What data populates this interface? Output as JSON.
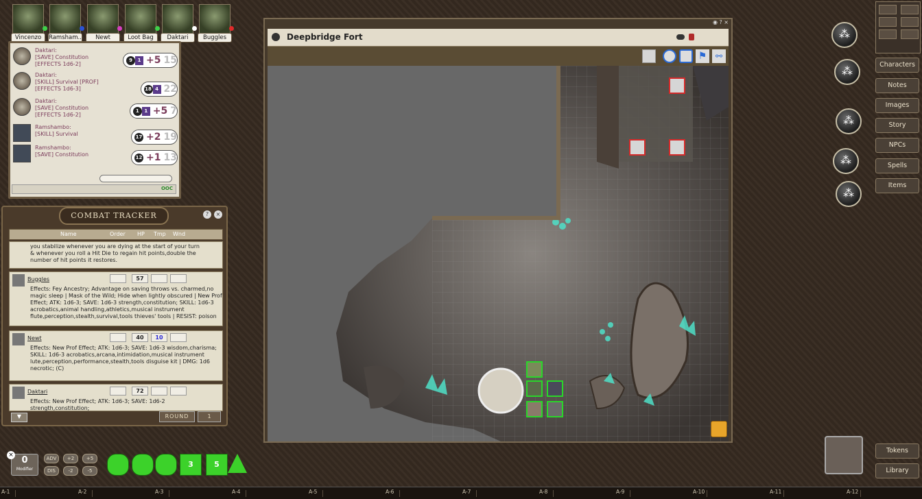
{
  "portraits": [
    {
      "name": "Vincenzo",
      "dot": "#3fd04a"
    },
    {
      "name": "Ramsham...",
      "dot": "#2a52d6"
    },
    {
      "name": "Newt",
      "dot": "#d63fc0"
    },
    {
      "name": "Loot Bag",
      "dot": "#3fd04a"
    },
    {
      "name": "Daktari",
      "dot": "#ffffff"
    },
    {
      "name": "Buggles",
      "dot": "#e12a2a"
    }
  ],
  "chat": {
    "messages": [
      {
        "who": "Daktari:",
        "l1": "[SAVE] Constitution",
        "l2": "[EFFECTS 1d6-2]",
        "die": "9",
        "prof": "1",
        "total": "+5",
        "grand": "15"
      },
      {
        "who": "Daktari:",
        "l1": "[SKILL] Survival [PROF]",
        "l2": "[EFFECTS 1d6-3]",
        "die": "18",
        "prof": "4",
        "total": "",
        "grand": "22"
      },
      {
        "who": "Daktari:",
        "l1": "[SAVE] Constitution",
        "l2": "[EFFECTS 1d6-2]",
        "die": "1",
        "prof": "1",
        "total": "+5",
        "grand": "7"
      },
      {
        "who": "Ramshambo:",
        "l1": "[SKILL] Survival",
        "l2": "",
        "die": "17",
        "prof": "",
        "total": "+2",
        "grand": "19"
      },
      {
        "who": "Ramshambo:",
        "l1": "[SAVE] Constitution",
        "l2": "",
        "die": "12",
        "prof": "",
        "total": "+1",
        "grand": "13"
      }
    ],
    "ooc": "OOC"
  },
  "combat": {
    "title": "COMBAT TRACKER",
    "headers": {
      "name": "Name",
      "order": "Order",
      "hp": "HP",
      "tmp": "Tmp",
      "wnd": "Wnd"
    },
    "top_text": "you stabilize whenever you are dying at the start of your turn & whenever you roll a Hit Die to regain hit points,double the number of hit points it restores.",
    "rows": [
      {
        "name": "Buggles",
        "hp": "57",
        "tmp": "",
        "effects": "Effects: Fey Ancestry; Advantage on saving throws vs. charmed,no magic sleep | Mask of the Wild; Hide when lightly obscured | New Prof Effect; ATK: 1d6-3; SAVE: 1d6-3 strength,constitution; SKILL: 1d6-3 acrobatics,animal handling,athletics,musical instrument flute,perception,stealth,survival,tools thieves' tools | RESIST: poison"
      },
      {
        "name": "Newt",
        "hp": "40",
        "tmp": "10",
        "effects": "Effects: New Prof Effect; ATK: 1d6-3; SAVE: 1d6-3 wisdom,charisma; SKILL: 1d6-3 acrobatics,arcana,intimidation,musical instrument lute,perception,performance,stealth,tools disguise kit | DMG: 1d6 necrotic; (C)"
      },
      {
        "name": "Daktari",
        "hp": "72",
        "tmp": "",
        "effects": "Effects: New Prof Effect; ATK: 1d6-3; SAVE: 1d6-2 strength,constitution;"
      }
    ],
    "round_label": "ROUND",
    "round": "1"
  },
  "map": {
    "title": "Deepbridge Fort"
  },
  "sidebar": {
    "top_icons": [
      "swords-icon",
      "dice-icon",
      "party-icon",
      "mask-icon",
      "plusminus-icon",
      "walk-icon"
    ],
    "buttons": [
      "Characters",
      "Notes",
      "Images",
      "Story",
      "NPCs",
      "Spells",
      "Items"
    ],
    "bottom_buttons": [
      "Tokens",
      "Library"
    ]
  },
  "dicebar": {
    "modifier": "0",
    "modifier_label": "Modifier",
    "mods": [
      "ADV",
      "+2",
      "+5",
      "DIS",
      "-2",
      "-5"
    ],
    "dice": [
      "d4",
      "d6",
      "d8",
      "d10",
      "d12",
      "d20"
    ],
    "dice_labels": [
      "",
      "",
      "",
      "3",
      "5",
      ""
    ]
  },
  "axis": [
    "A-1",
    "A-2",
    "A-3",
    "A-4",
    "A-5",
    "A-6",
    "A-7",
    "A-8",
    "A-9",
    "A-10",
    "A-11",
    "A-12"
  ]
}
